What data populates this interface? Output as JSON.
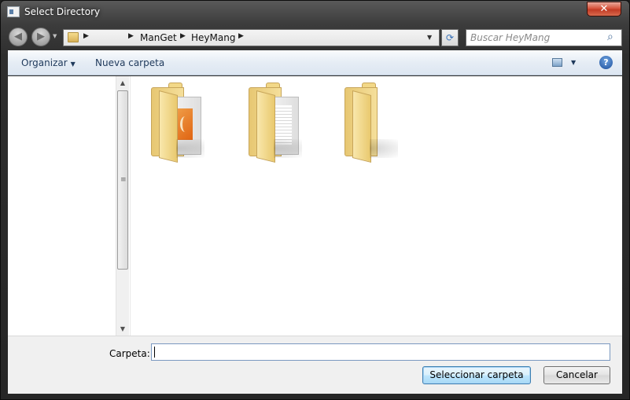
{
  "window": {
    "title": "Select Directory",
    "close_label": "✕"
  },
  "navigation": {
    "back_icon": "arrow-left-icon",
    "forward_icon": "arrow-right-icon",
    "breadcrumb": [
      "ManGet",
      "HeyMang"
    ],
    "search_placeholder": "Buscar HeyMang"
  },
  "toolbar": {
    "organize_label": "Organizar",
    "new_folder_label": "Nueva carpeta",
    "help_label": "?"
  },
  "file_pane": {
    "items": [
      {
        "icon": "folder-image-icon"
      },
      {
        "icon": "folder-documents-icon"
      },
      {
        "icon": "folder-icon"
      }
    ]
  },
  "bottom": {
    "folder_label": "Carpeta:",
    "folder_value": "",
    "select_button_label": "Seleccionar carpeta",
    "cancel_button_label": "Cancelar"
  },
  "colors": {
    "title_bar": "#3c3c3c",
    "toolbar_text": "#1e395b",
    "close_button": "#c23b24",
    "primary_button": "#3c7fb1"
  }
}
